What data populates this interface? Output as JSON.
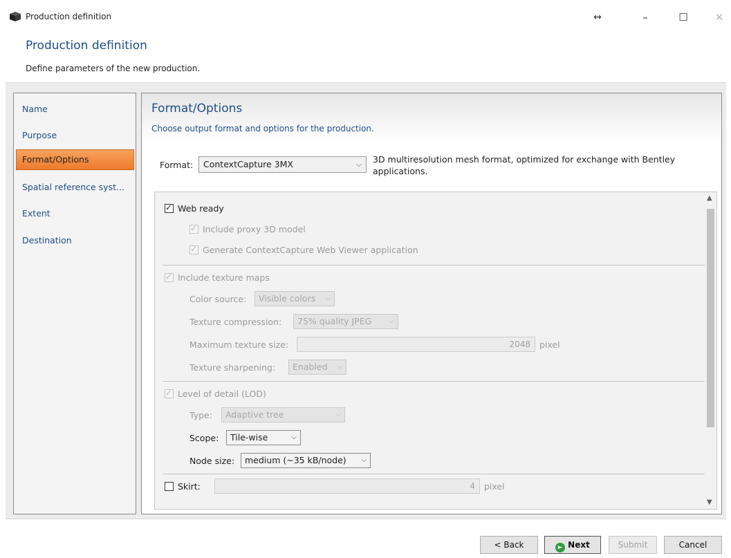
{
  "window": {
    "title": "Production definition",
    "icon": "cube-icon",
    "controls": [
      "resize-arrows-icon",
      "minimize-icon",
      "maximize-icon",
      "close-icon"
    ]
  },
  "header": {
    "title": "Production definition",
    "description": "Define parameters of the new production."
  },
  "sidebar": {
    "items": [
      {
        "label": "Name",
        "active": false
      },
      {
        "label": "Purpose",
        "active": false
      },
      {
        "label": "Format/Options",
        "active": true
      },
      {
        "label": "Spatial reference syst...",
        "active": false
      },
      {
        "label": "Extent",
        "active": false
      },
      {
        "label": "Destination",
        "active": false
      }
    ]
  },
  "main": {
    "title": "Format/Options",
    "subtitle": "Choose output format and options for the production.",
    "format": {
      "label": "Format:",
      "value": "ContextCapture 3MX",
      "description": "3D multiresolution mesh format, optimized for exchange with Bentley applications."
    }
  },
  "options": {
    "web_ready": {
      "label": "Web ready",
      "checked": true
    },
    "include_proxy": {
      "label": "Include proxy 3D model",
      "checked": true
    },
    "generate_viewer": {
      "label": "Generate ContextCapture Web Viewer application",
      "checked": true
    },
    "include_texture": {
      "label": "Include texture maps",
      "checked": true
    },
    "color_source": {
      "label": "Color source:",
      "value": "Visible colors"
    },
    "texture_compression": {
      "label": "Texture compression:",
      "value": "75% quality JPEG"
    },
    "max_texture_size": {
      "label": "Maximum texture size:",
      "value": "2048",
      "unit": "pixel"
    },
    "texture_sharpening": {
      "label": "Texture sharpening:",
      "value": "Enabled"
    },
    "lod": {
      "label": "Level of detail (LOD)",
      "checked": true
    },
    "lod_type": {
      "label": "Type:",
      "value": "Adaptive tree"
    },
    "scope": {
      "label": "Scope:",
      "value": "Tile-wise"
    },
    "node_size": {
      "label": "Node size:",
      "value": "medium (~35 kB/node)"
    },
    "skirt": {
      "label": "Skirt:",
      "checked": false,
      "value": "4",
      "unit": "pixel"
    }
  },
  "buttons": {
    "back": "< Back",
    "next": "Next",
    "submit": "Submit",
    "cancel": "Cancel"
  },
  "colors": {
    "accent_orange": "#ee7a2c",
    "title_blue": "#1f4e86",
    "next_green": "#2f9c3a"
  }
}
